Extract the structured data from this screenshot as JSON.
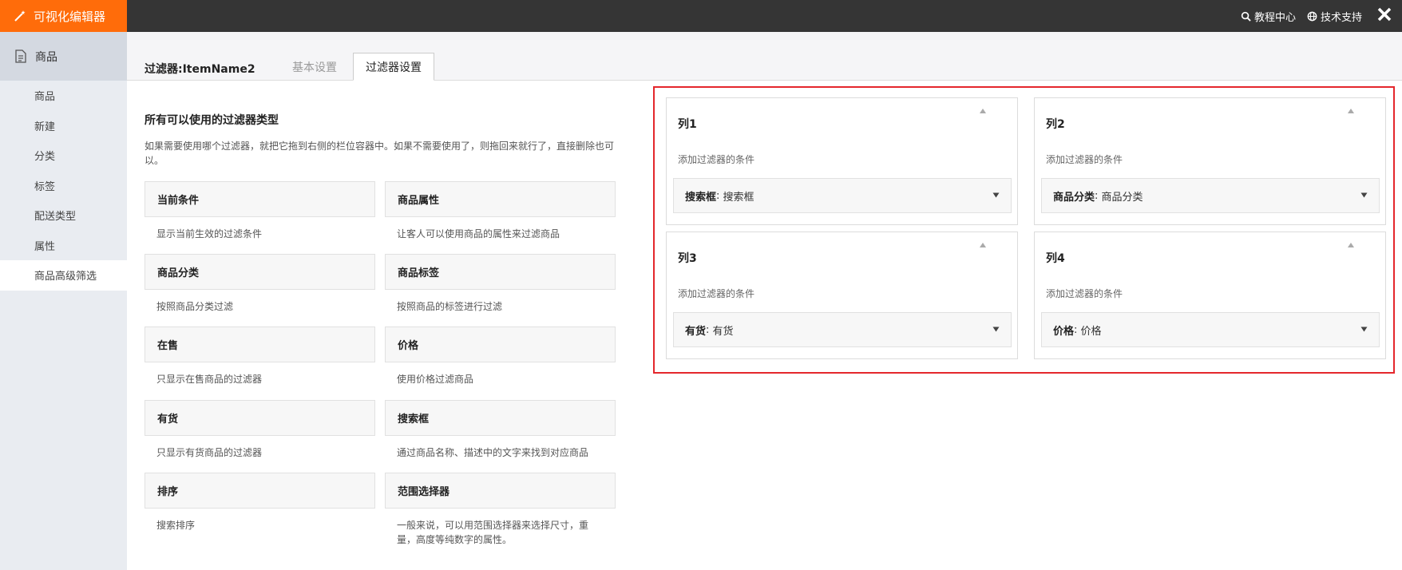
{
  "app": {
    "title": "可视化编辑器"
  },
  "top_links": [
    {
      "label": "教程中心",
      "icon": "search-icon"
    },
    {
      "label": "技术支持",
      "icon": "globe-icon"
    }
  ],
  "sidebar": {
    "section": "商品",
    "items": [
      {
        "label": "商品"
      },
      {
        "label": "新建"
      },
      {
        "label": "分类"
      },
      {
        "label": "标签"
      },
      {
        "label": "配送类型"
      },
      {
        "label": "属性"
      },
      {
        "label": "商品高级筛选",
        "active": true
      }
    ]
  },
  "page": {
    "title": "过滤器:ItemName2",
    "tabs": [
      {
        "label": "基本设置",
        "active": false
      },
      {
        "label": "过滤器设置",
        "active": true
      }
    ]
  },
  "available": {
    "title": "所有可以使用的过滤器类型",
    "description": "如果需要使用哪个过滤器，就把它拖到右侧的栏位容器中。如果不需要使用了，则拖回来就行了，直接删除也可以。",
    "widgets": [
      {
        "name": "当前条件",
        "desc": "显示当前生效的过滤条件"
      },
      {
        "name": "商品属性",
        "desc": "让客人可以使用商品的属性来过滤商品"
      },
      {
        "name": "商品分类",
        "desc": "按照商品分类过滤"
      },
      {
        "name": "商品标签",
        "desc": "按照商品的标签进行过滤"
      },
      {
        "name": "在售",
        "desc": "只显示在售商品的过滤器"
      },
      {
        "name": "价格",
        "desc": "使用价格过滤商品"
      },
      {
        "name": "有货",
        "desc": "只显示有货商品的过滤器"
      },
      {
        "name": "搜索框",
        "desc": "通过商品名称、描述中的文字来找到对应商品"
      },
      {
        "name": "排序",
        "desc": "搜索排序"
      },
      {
        "name": "范围选择器",
        "desc": "一般来说，可以用范围选择器来选择尺寸，重量，高度等纯数字的属性。"
      }
    ]
  },
  "columns": [
    {
      "title": "列1",
      "hint": "添加过滤器的条件",
      "item_name": "搜索框",
      "item_value": "搜索框"
    },
    {
      "title": "列2",
      "hint": "添加过滤器的条件",
      "item_name": "商品分类",
      "item_value": "商品分类"
    },
    {
      "title": "列3",
      "hint": "添加过滤器的条件",
      "item_name": "有货",
      "item_value": "有货"
    },
    {
      "title": "列4",
      "hint": "添加过滤器的条件",
      "item_name": "价格",
      "item_value": "价格"
    }
  ],
  "colors": {
    "brand": "#ff6c0a",
    "topbar": "#353535",
    "highlight": "#e4272c"
  }
}
